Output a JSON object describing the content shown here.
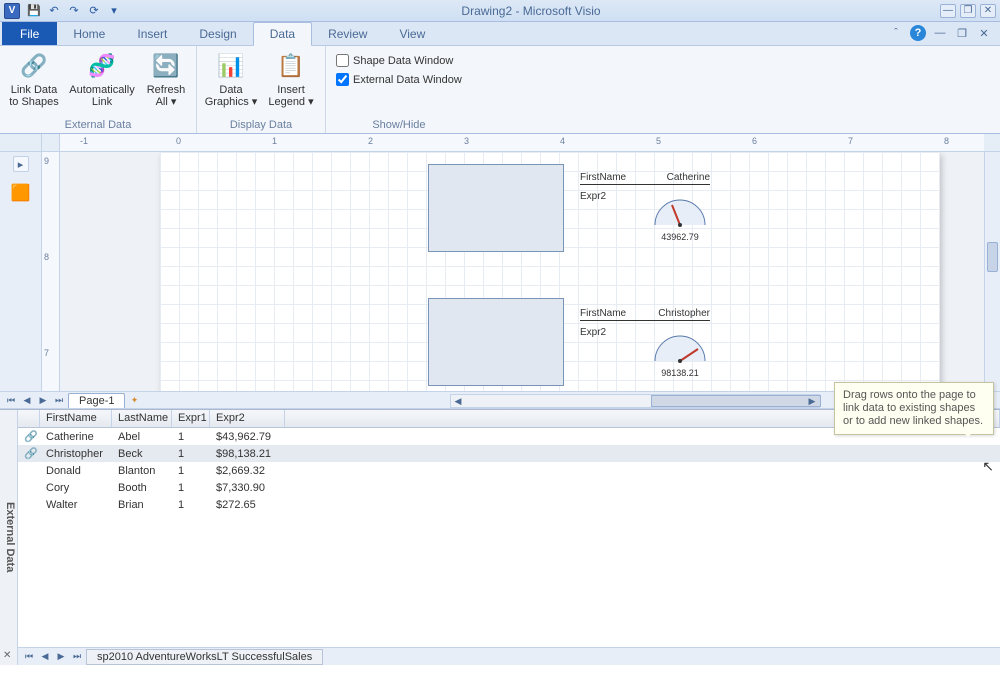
{
  "app": {
    "icon_letter": "V",
    "title": "Drawing2 - Microsoft Visio"
  },
  "qat": {
    "save": "💾",
    "undo": "↶",
    "redo": "↷",
    "refresh": "⟳"
  },
  "tabs": {
    "file": "File",
    "home": "Home",
    "insert": "Insert",
    "design": "Design",
    "data": "Data",
    "review": "Review",
    "view": "View"
  },
  "ribbon": {
    "external_data": {
      "label": "External Data",
      "link_data": "Link Data\nto Shapes",
      "auto_link": "Automatically\nLink",
      "refresh": "Refresh\nAll"
    },
    "display_data": {
      "label": "Display Data",
      "data_graphics": "Data\nGraphics",
      "insert_legend": "Insert\nLegend"
    },
    "show_hide": {
      "label": "Show/Hide",
      "shape_data_window": "Shape Data Window",
      "external_data_window": "External Data Window"
    }
  },
  "ruler": {
    "h": [
      "-1",
      "0",
      "1",
      "2",
      "3",
      "4",
      "5",
      "6",
      "7",
      "8"
    ],
    "v": [
      "9",
      "8",
      "7"
    ]
  },
  "canvas": {
    "callouts": [
      {
        "label_fn": "FirstName",
        "value_fn": "Catherine",
        "label_e": "Expr2",
        "value_e": "43962.79",
        "needle": -20
      },
      {
        "label_fn": "FirstName",
        "value_fn": "Christopher",
        "label_e": "Expr2",
        "value_e": "98138.21",
        "needle": 55
      }
    ]
  },
  "pagetabs": {
    "page1": "Page-1"
  },
  "tooltip": "Drag rows onto the page to link data to existing shapes or to add new linked shapes.",
  "external": {
    "pane_label": "External Data",
    "headers": [
      "FirstName",
      "LastName",
      "Expr1",
      "Expr2"
    ],
    "rows": [
      {
        "linked": true,
        "FirstName": "Catherine",
        "LastName": "Abel",
        "Expr1": "1",
        "Expr2": "$43,962.79"
      },
      {
        "linked": true,
        "FirstName": "Christopher",
        "LastName": "Beck",
        "Expr1": "1",
        "Expr2": "$98,138.21",
        "selected": true
      },
      {
        "linked": false,
        "FirstName": "Donald",
        "LastName": "Blanton",
        "Expr1": "1",
        "Expr2": "$2,669.32"
      },
      {
        "linked": false,
        "FirstName": "Cory",
        "LastName": "Booth",
        "Expr1": "1",
        "Expr2": "$7,330.90"
      },
      {
        "linked": false,
        "FirstName": "Walter",
        "LastName": "Brian",
        "Expr1": "1",
        "Expr2": "$272.65"
      }
    ],
    "datasource_tab": "sp2010 AdventureWorksLT SuccessfulSales"
  }
}
